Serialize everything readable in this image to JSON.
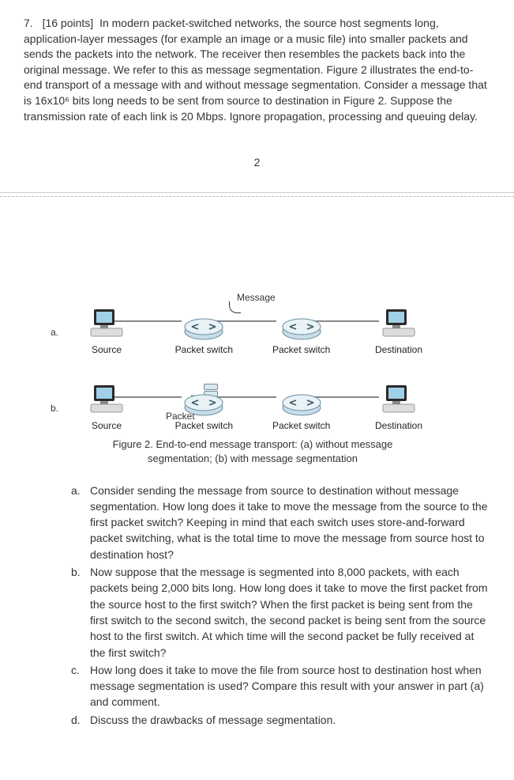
{
  "q": {
    "num": "7.",
    "points": "[16 points]",
    "text": "In modern packet-switched networks, the source host segments long, application-layer messages (for example an image or a music file) into smaller packets and sends the packets into the network. The receiver then resembles the packets back into the original message. We refer to this as message segmentation. Figure 2 illustrates the end-to-end transport of a message with and without message segmentation. Consider a message that is 16x10⁶ bits long needs to be sent from source to destination in Figure 2. Suppose the transmission rate of each link is 20 Mbps. Ignore propagation, processing and queuing delay."
  },
  "pagenum": "2",
  "fig": {
    "a": "a.",
    "b": "b.",
    "source": "Source",
    "dest": "Destination",
    "ps": "Packet switch",
    "msg": "Message",
    "pkt": "Packet",
    "caption": "Figure 2. End-to-end message transport: (a) without message segmentation;  (b) with message segmentation"
  },
  "subs": {
    "a": {
      "l": "a.",
      "t": "Consider sending the message from source to destination without message segmentation. How long does it take to move the message from the source to the first packet switch? Keeping in mind that each switch uses store-and-forward packet switching, what is the total time to move the message from source host to destination host?"
    },
    "b": {
      "l": "b.",
      "t": "Now suppose that the message is segmented into 8,000 packets, with each packets being 2,000 bits long. How long does it take to move the first packet from the source host to the first switch? When the first packet is being sent from the first switch to the second switch, the second packet is being sent from the source host to the first switch. At which time will the second packet be fully received at the first switch?"
    },
    "c": {
      "l": "c.",
      "t": "How long does it take to move the file from source host to destination host when message segmentation is used? Compare this result with your answer in part (a) and comment."
    },
    "d": {
      "l": "d.",
      "t": "Discuss the drawbacks of message segmentation."
    }
  }
}
